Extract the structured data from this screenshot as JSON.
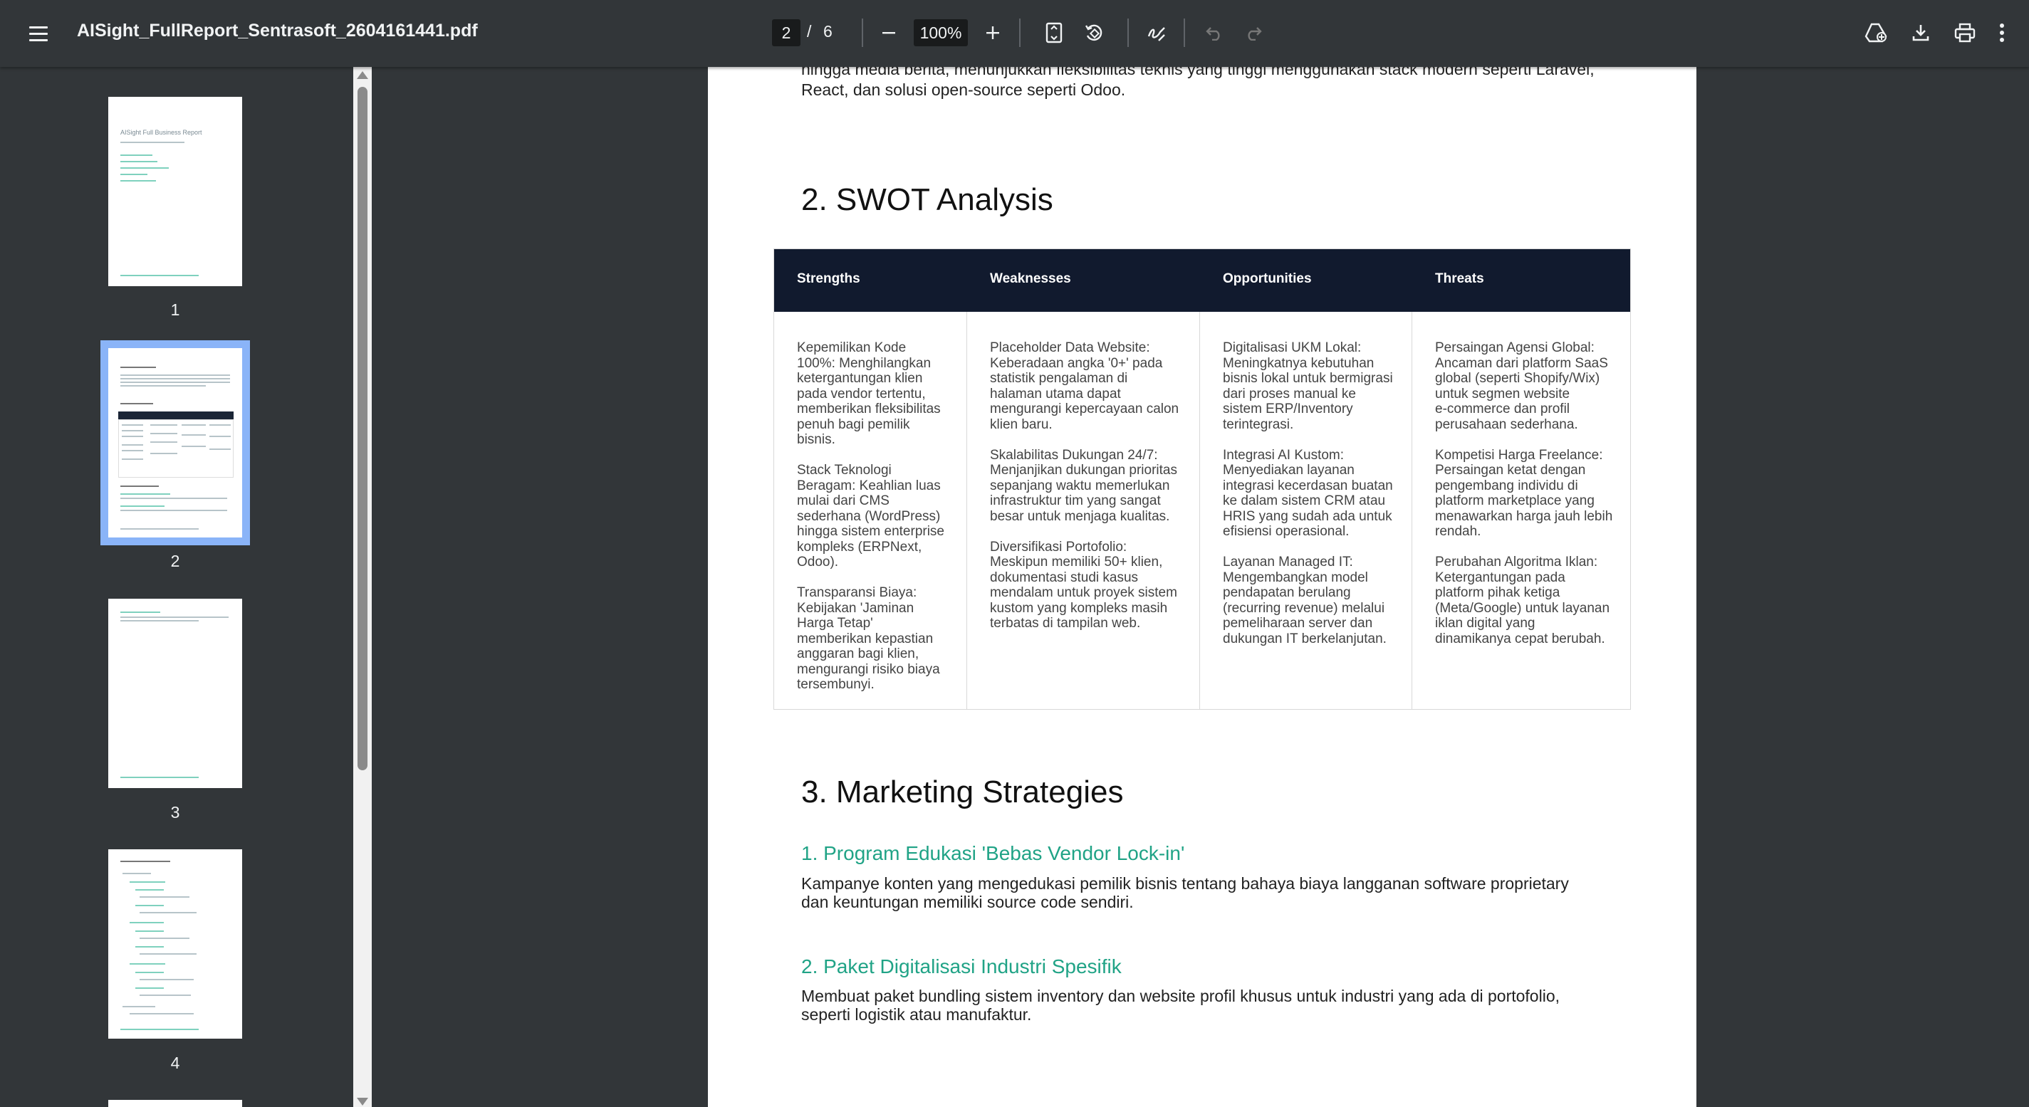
{
  "toolbar": {
    "filename": "AISight_FullReport_Sentrasoft_2604161441.pdf",
    "current_page": "2",
    "page_separator": "/",
    "total_pages": "6",
    "zoom": "100%"
  },
  "sidebar": {
    "thumbnails": [
      {
        "label": "1",
        "title": "AISight Full Business Report"
      },
      {
        "label": "2"
      },
      {
        "label": "3"
      },
      {
        "label": "4"
      }
    ]
  },
  "page": {
    "intro_lines": [
      "hingga media berita, menunjukkan fleksibilitas teknis yang tinggi menggunakan stack modern seperti Laravel,",
      "React, dan solusi open-source seperti Odoo."
    ],
    "swot_heading": "2. SWOT Analysis",
    "swot": {
      "headers": [
        "Strengths",
        "Weaknesses",
        "Opportunities",
        "Threats"
      ],
      "cells": [
        "Kepemilikan Kode\n100%: Menghilangkan\nketergantungan klien\npada vendor tertentu,\nmemberikan fleksibilitas\npenuh bagi pemilik\nbisnis.\n\nStack Teknologi\nBeragam: Keahlian luas\nmulai dari CMS\nsederhana (WordPress)\nhingga sistem enterprise\nkompleks (ERPNext,\nOdoo).\n\nTransparansi Biaya:\nKebijakan 'Jaminan\nHarga Tetap'\nmemberikan kepastian\nanggaran bagi klien,\nmengurangi risiko biaya\ntersembunyi.",
        "Placeholder Data Website:\nKeberadaan angka '0+' pada\nstatistik pengalaman di\nhalaman utama dapat\nmengurangi kepercayaan calon\nklien baru.\n\nSkalabilitas Dukungan 24/7:\nMenjanjikan dukungan prioritas\nsepanjang waktu memerlukan\ninfrastruktur tim yang sangat\nbesar untuk menjaga kualitas.\n\nDiversifikasi Portofolio:\nMeskipun memiliki 50+ klien,\ndokumentasi studi kasus\nmendalam untuk proyek sistem\nkustom yang kompleks masih\nterbatas di tampilan web.",
        "Digitalisasi UKM Lokal:\nMeningkatnya kebutuhan\nbisnis lokal untuk bermigrasi\ndari proses manual ke\nsistem ERP/Inventory\nterintegrasi.\n\nIntegrasi AI Kustom:\nMenyediakan layanan\nintegrasi kecerdasan buatan\nke dalam sistem CRM atau\nHRIS yang sudah ada untuk\nefisiensi operasional.\n\nLayanan Managed IT:\nMengembangkan model\npendapatan berulang\n(recurring revenue) melalui\npemeliharaan server dan\ndukungan IT berkelanjutan.",
        "Persaingan Agensi Global:\nAncaman dari platform SaaS\nglobal (seperti Shopify/Wix)\nuntuk segmen website\ne-commerce dan profil\nperusahaan sederhana.\n\nKompetisi Harga Freelance:\nPersaingan ketat dengan\npengembang individu di\nplatform marketplace yang\nmenawarkan harga jauh lebih\nrendah.\n\nPerubahan Algoritma Iklan:\nKetergantungan pada\nplatform pihak ketiga\n(Meta/Google) untuk layanan\niklan digital yang\ndinamikanya cepat berubah."
      ]
    },
    "marketing_heading": "3. Marketing Strategies",
    "strategies": [
      {
        "title": "1. Program Edukasi 'Bebas Vendor Lock-in'",
        "desc": "Kampanye konten yang mengedukasi pemilik bisnis tentang bahaya biaya langganan software proprietary\ndan keuntungan memiliki source code sendiri."
      },
      {
        "title": "2. Paket Digitalisasi Industri Spesifik",
        "desc": "Membuat paket bundling sistem inventory dan website profil khusus untuk industri yang ada di portofolio,\nseperti logistik atau manufaktur."
      }
    ]
  },
  "colors": {
    "toolbar_bg": "#323639",
    "table_header_bg": "#111a2e",
    "accent_teal": "#20a386",
    "thumb_active_border": "#8ab4f8"
  },
  "icons": [
    "menu-icon",
    "zoom-out-icon",
    "zoom-in-icon",
    "fit-page-icon",
    "rotate-icon",
    "annotate-icon",
    "undo-icon",
    "redo-icon",
    "save-to-drive-icon",
    "download-icon",
    "print-icon",
    "more-icon"
  ]
}
